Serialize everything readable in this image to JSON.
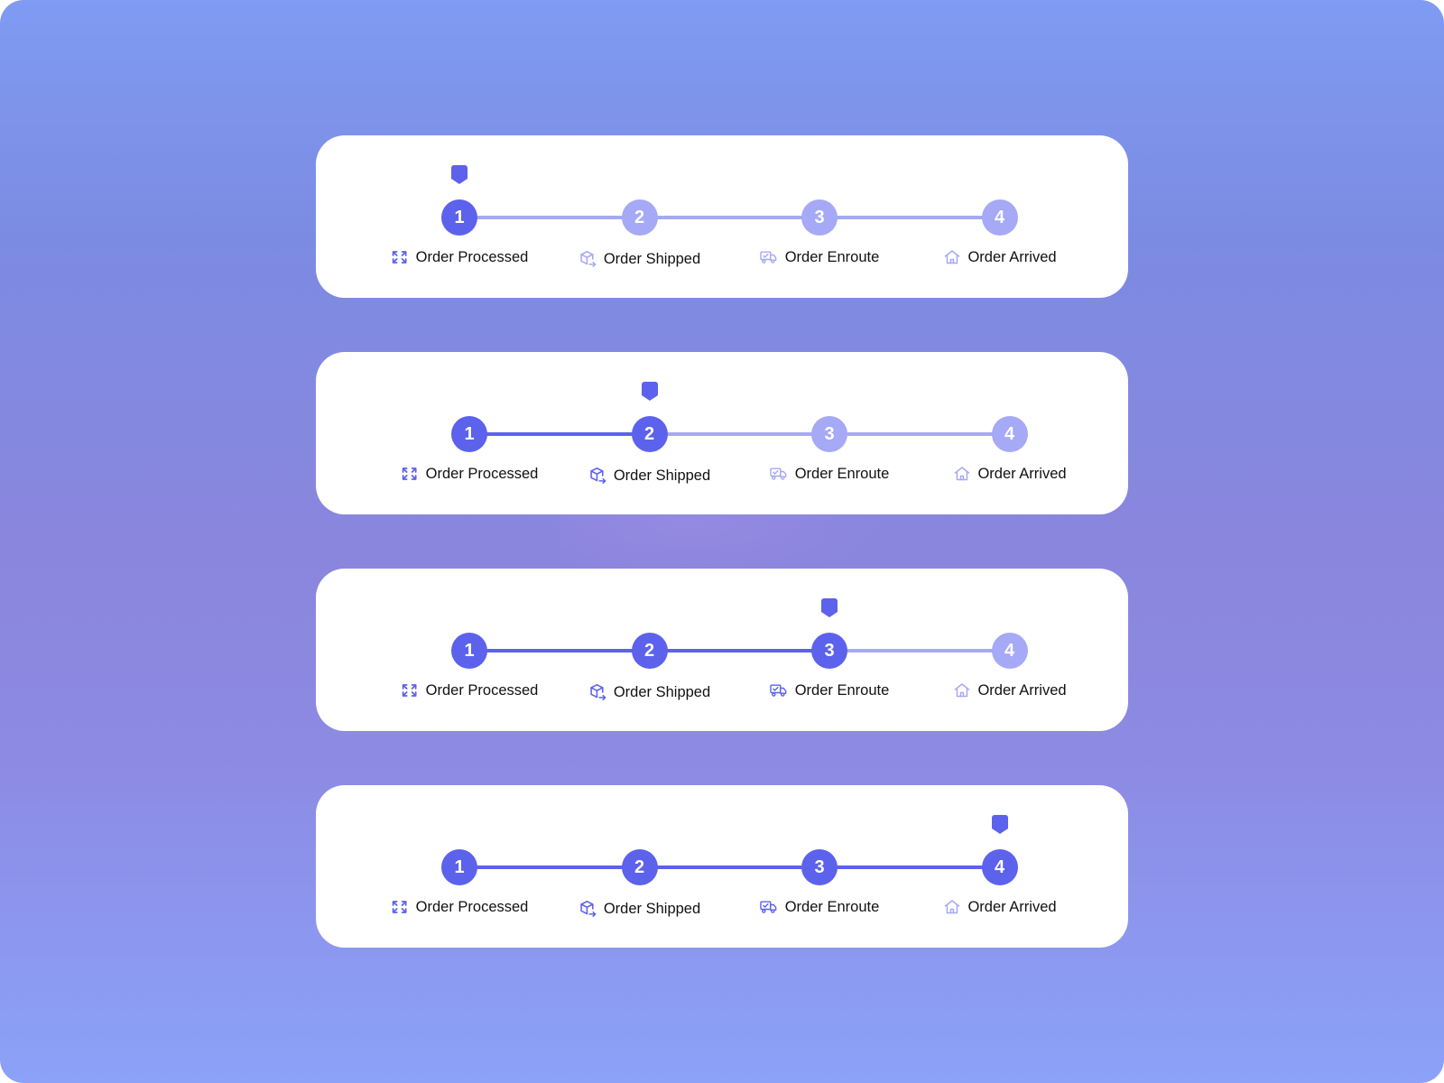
{
  "colors": {
    "active": "#5c62ec",
    "inactive": "#a6a9f5",
    "text": "#111111",
    "card": "#ffffff"
  },
  "steps": [
    {
      "number": "1",
      "label": "Order Processed",
      "icon": "processing-arrows-icon"
    },
    {
      "number": "2",
      "label": "Order Shipped",
      "icon": "package-shipped-icon"
    },
    {
      "number": "3",
      "label": "Order Enroute",
      "icon": "delivery-truck-icon"
    },
    {
      "number": "4",
      "label": "Order Arrived",
      "icon": "home-icon"
    }
  ],
  "trackers": [
    {
      "current_step": 1,
      "icons_active": [
        true,
        false,
        false,
        false
      ]
    },
    {
      "current_step": 2,
      "icons_active": [
        true,
        true,
        false,
        false
      ]
    },
    {
      "current_step": 3,
      "icons_active": [
        true,
        true,
        true,
        false
      ]
    },
    {
      "current_step": 4,
      "icons_active": [
        true,
        true,
        true,
        false
      ]
    }
  ]
}
